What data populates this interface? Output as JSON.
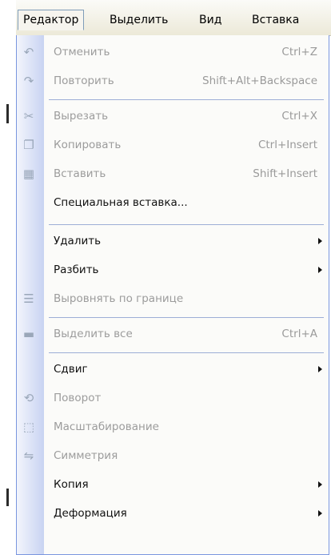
{
  "menubar": {
    "items": [
      {
        "label": "Редактор"
      },
      {
        "label": "Выделить"
      },
      {
        "label": "Вид"
      },
      {
        "label": "Вставка"
      }
    ]
  },
  "menu": {
    "undo": {
      "label": "Отменить",
      "shortcut": "Ctrl+Z"
    },
    "redo": {
      "label": "Повторить",
      "shortcut": "Shift+Alt+Backspace"
    },
    "cut": {
      "label": "Вырезать",
      "shortcut": "Ctrl+X"
    },
    "copy": {
      "label": "Копировать",
      "shortcut": "Ctrl+Insert"
    },
    "paste": {
      "label": "Вставить",
      "shortcut": "Shift+Insert"
    },
    "paste_special": {
      "label": "Специальная вставка..."
    },
    "delete": {
      "label": "Удалить"
    },
    "split": {
      "label": "Разбить"
    },
    "align_border": {
      "label": "Выровнять по границе"
    },
    "select_all": {
      "label": "Выделить все",
      "shortcut": "Ctrl+A"
    },
    "shift": {
      "label": "Сдвиг"
    },
    "rotate": {
      "label": "Поворот"
    },
    "scale": {
      "label": "Масштабирование"
    },
    "symmetry": {
      "label": "Симметрия"
    },
    "copy_sub": {
      "label": "Копия"
    },
    "deform": {
      "label": "Деформация"
    }
  },
  "colors": {
    "strip": "#c8d3f2",
    "separator": "#9daed6",
    "active_border": "#7f9db9"
  }
}
